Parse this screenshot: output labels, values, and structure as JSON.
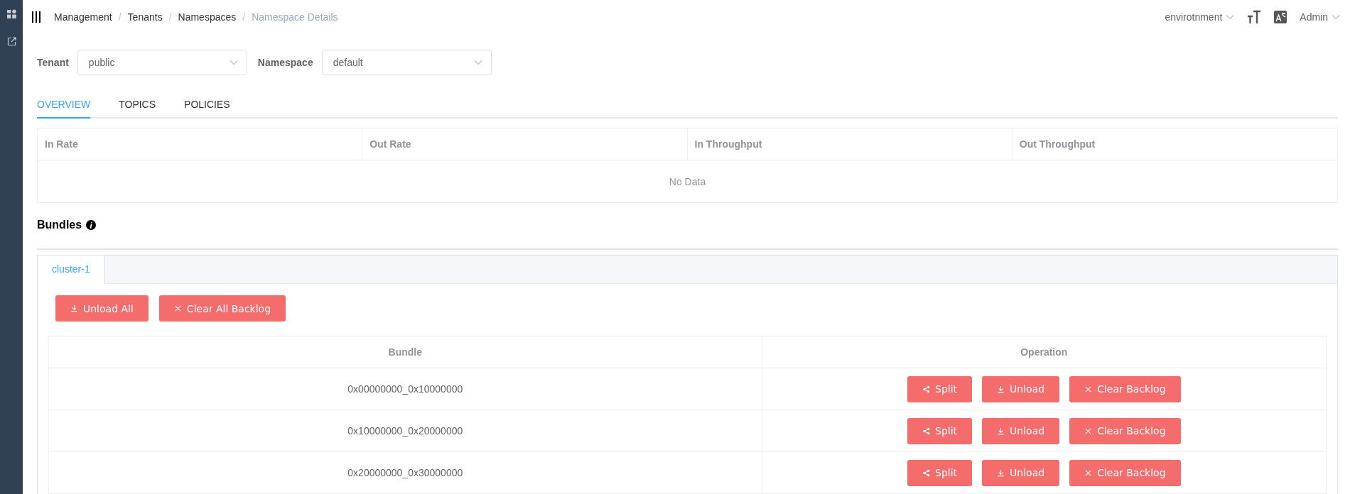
{
  "header": {
    "breadcrumbs": [
      {
        "label": "Management",
        "current": false
      },
      {
        "label": "Tenants",
        "current": false
      },
      {
        "label": "Namespaces",
        "current": false
      },
      {
        "label": "Namespace Details",
        "current": true
      }
    ],
    "separator": "/",
    "environment": "envirotnment",
    "user": "Admin"
  },
  "filters": [
    {
      "label": "Tenant",
      "value": "public"
    },
    {
      "label": "Namespace",
      "value": "default"
    }
  ],
  "tabs": [
    {
      "label": "OVERVIEW",
      "selected": true
    },
    {
      "label": "TOPICS",
      "selected": false
    },
    {
      "label": "POLICIES",
      "selected": false
    }
  ],
  "stats": {
    "columns": [
      "In Rate",
      "Out Rate",
      "In Throughput",
      "Out Throughput"
    ],
    "empty_text": "No Data"
  },
  "bundles": {
    "title": "Bundles",
    "cluster_tabs": [
      {
        "label": "cluster-1",
        "selected": true
      }
    ],
    "actions": [
      {
        "label": "Unload All",
        "kind": "download"
      },
      {
        "label": "Clear All Backlog",
        "kind": "close"
      }
    ],
    "table": {
      "columns": [
        "Bundle",
        "Operation"
      ],
      "rows": [
        {
          "bundle": "0x00000000_0x10000000",
          "operations": [
            {
              "label": "Split",
              "kind": "share"
            },
            {
              "label": "Unload",
              "kind": "download"
            },
            {
              "label": "Clear Backlog",
              "kind": "close"
            }
          ]
        },
        {
          "bundle": "0x10000000_0x20000000",
          "operations": [
            {
              "label": "Split",
              "kind": "share"
            },
            {
              "label": "Unload",
              "kind": "download"
            },
            {
              "label": "Clear Backlog",
              "kind": "close"
            }
          ]
        },
        {
          "bundle": "0x20000000_0x30000000",
          "operations": [
            {
              "label": "Split",
              "kind": "share"
            },
            {
              "label": "Unload",
              "kind": "download"
            },
            {
              "label": "Clear Backlog",
              "kind": "close"
            }
          ]
        }
      ]
    }
  }
}
